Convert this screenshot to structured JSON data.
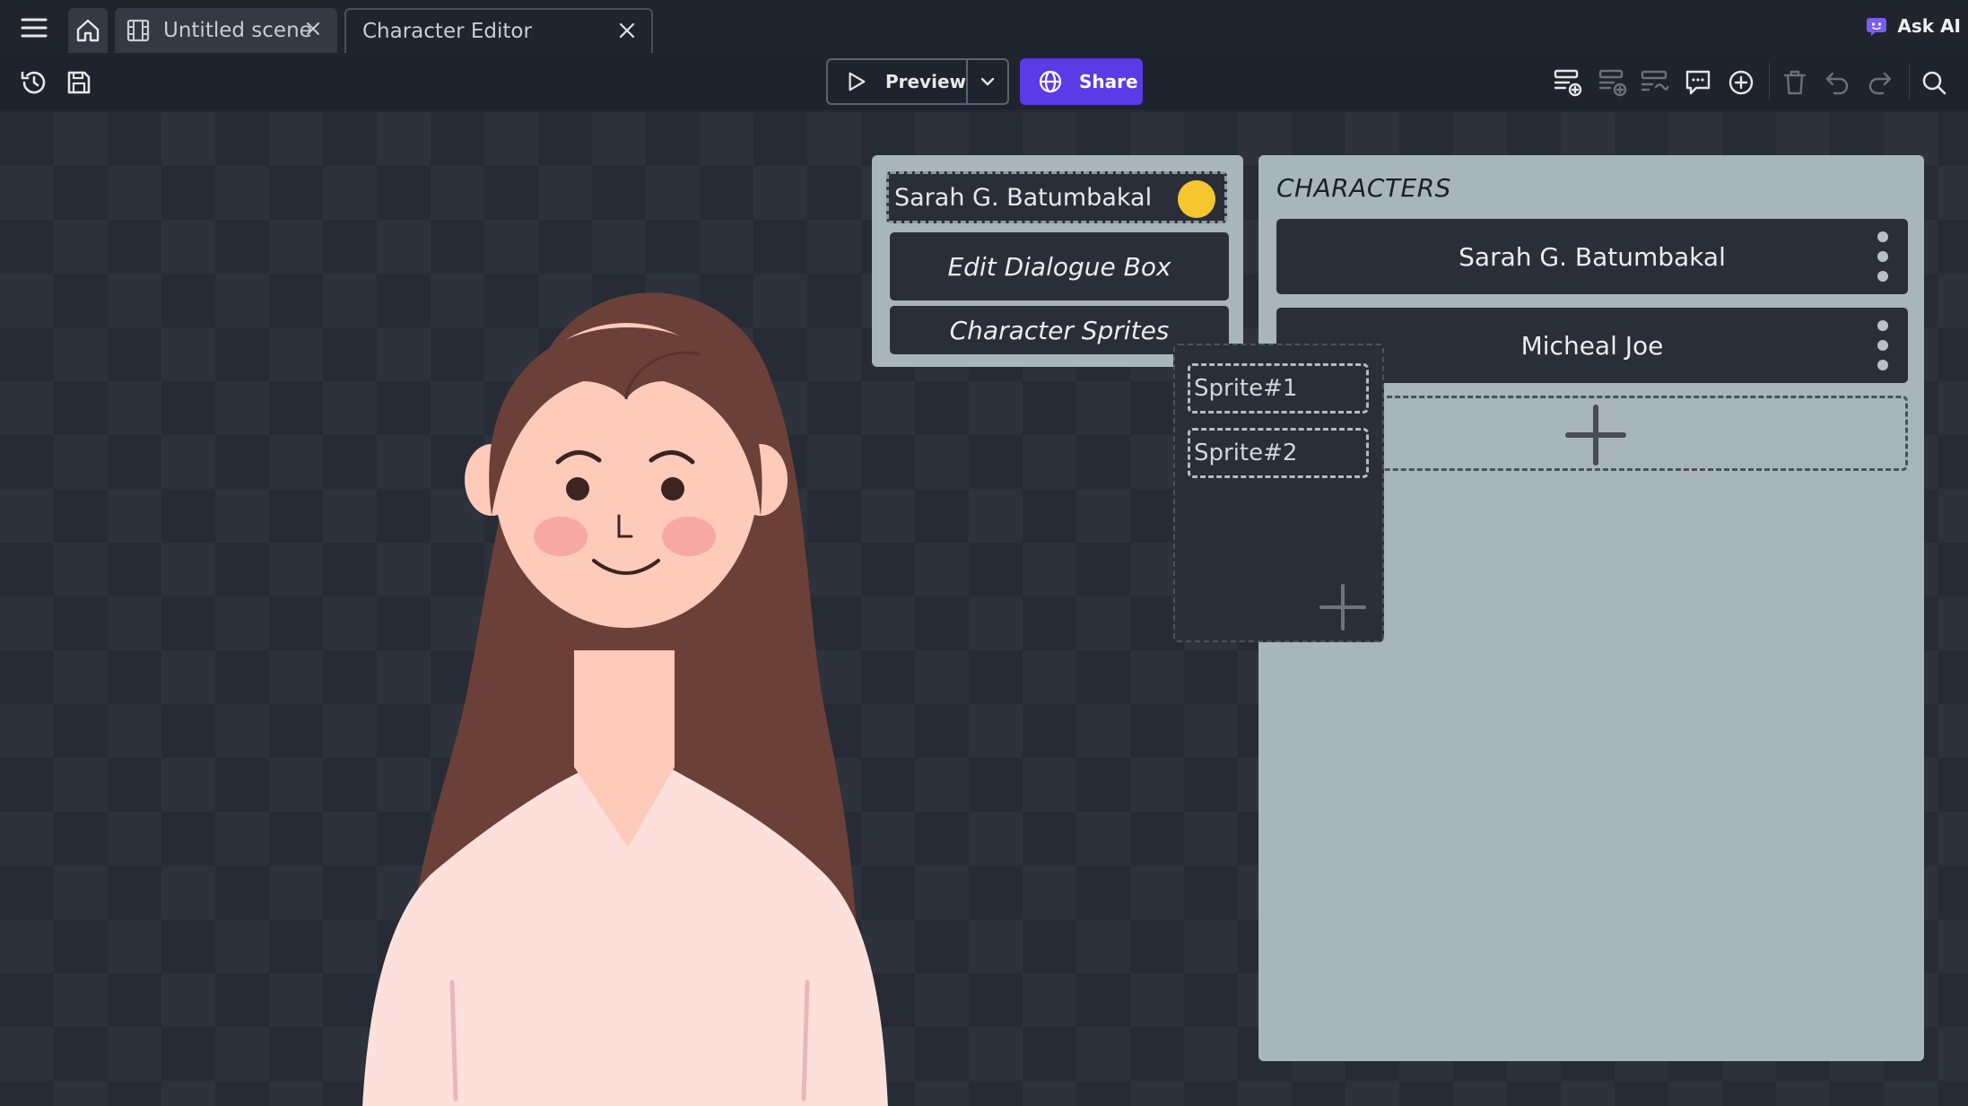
{
  "tabs": [
    {
      "label": "Untitled scene"
    },
    {
      "label": "Character Editor"
    }
  ],
  "ask_ai": {
    "label": "Ask AI"
  },
  "toolbar": {
    "preview_label": "Preview",
    "share_label": "Share"
  },
  "colors": {
    "accent": "#5a3be6",
    "panel": "#a8b5bd",
    "dark_button": "#2a2e38",
    "character_color": "#f6c62e"
  },
  "character_detail": {
    "name": "Sarah G. Batumbakal",
    "edit_dialogue_label": "Edit Dialogue Box",
    "sprites_label": "Character Sprites"
  },
  "sprites": {
    "items": [
      {
        "label": "Sprite#1"
      },
      {
        "label": "Sprite#2"
      }
    ]
  },
  "characters": {
    "title": "CHARACTERS",
    "items": [
      {
        "name": "Sarah G. Batumbakal"
      },
      {
        "name": "Micheal Joe"
      }
    ]
  },
  "icons": [
    "menu-icon",
    "home-icon",
    "film-icon",
    "close-icon",
    "ai-icon",
    "history-icon",
    "save-icon",
    "play-icon",
    "chevron-down-icon",
    "globe-icon",
    "add-row-icon",
    "add-variant-icon",
    "swap-icon",
    "comment-icon",
    "plus-circle-icon",
    "trash-icon",
    "undo-icon",
    "redo-icon",
    "search-icon",
    "plus-icon",
    "kebab-menu-icon"
  ]
}
